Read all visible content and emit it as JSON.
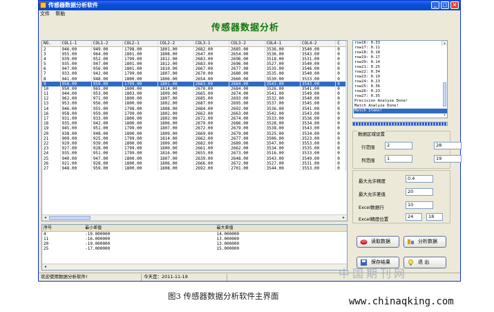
{
  "window": {
    "title": "传感器数据分析软件",
    "menu": [
      "文件",
      "帮助"
    ],
    "app_title": "传感器数据分析"
  },
  "grid": {
    "headers": [
      "NO.",
      "COL1-1",
      "COL1-2",
      "COL2-1",
      "COL2-2",
      "COL3-1",
      "COL3-2",
      "COL4-1",
      "COL4-2",
      "C"
    ],
    "rows": [
      [
        "2",
        "946.00",
        "949.00",
        "1798.00",
        "1801.00",
        "2682.00",
        "2685.00",
        "3536.00",
        "3540.00",
        "0"
      ],
      [
        "3",
        "955.00",
        "964.00",
        "1801.00",
        "1808.00",
        "2647.00",
        "2654.00",
        "3536.00",
        "3543.00",
        "0"
      ],
      [
        "4",
        "939.00",
        "952.00",
        "1799.00",
        "1812.00",
        "2683.00",
        "2696.00",
        "3518.00",
        "3531.00",
        "0"
      ],
      [
        "5",
        "935.00",
        "947.00",
        "1801.00",
        "1812.00",
        "2683.00",
        "2696.00",
        "3527.00",
        "3540.00",
        "0"
      ],
      [
        "6",
        "947.00",
        "956.00",
        "1801.00",
        "1810.00",
        "2667.00",
        "2677.00",
        "3535.00",
        "3546.00",
        "0"
      ],
      [
        "7",
        "933.00",
        "942.00",
        "1799.00",
        "1807.00",
        "2670.00",
        "2680.00",
        "3535.00",
        "3540.00",
        "0"
      ],
      [
        "8",
        "941.00",
        "948.00",
        "1800.00",
        "1806.00",
        "2654.00",
        "2660.00",
        "3530.00",
        "3533.00",
        "0"
      ],
      [
        "9",
        "958.00",
        "959.00",
        "1799.00",
        "1801.00",
        "2683.00",
        "2684.00",
        "3543.00",
        "3543.00",
        "0"
      ],
      [
        "10",
        "950.00",
        "965.00",
        "1800.00",
        "1814.00",
        "2670.00",
        "2684.00",
        "3526.00",
        "3541.00",
        "0"
      ],
      [
        "11",
        "944.00",
        "953.00",
        "1803.00",
        "1809.00",
        "2665.00",
        "2674.00",
        "3541.00",
        "3549.00",
        "0"
      ],
      [
        "12",
        "962.00",
        "971.00",
        "1800.00",
        "1807.00",
        "2685.00",
        "2693.00",
        "3532.00",
        "3540.00",
        "0"
      ],
      [
        "13",
        "953.00",
        "956.00",
        "1800.00",
        "1802.00",
        "2687.00",
        "2695.00",
        "3537.00",
        "3545.00",
        "0"
      ],
      [
        "14",
        "946.00",
        "955.00",
        "1798.00",
        "1808.00",
        "2684.00",
        "2692.00",
        "3536.00",
        "3541.00",
        "0"
      ],
      [
        "16",
        "958.00",
        "959.00",
        "1799.00",
        "1802.00",
        "2662.00",
        "2663.00",
        "3542.00",
        "3543.00",
        "0"
      ],
      [
        "17",
        "931.00",
        "933.00",
        "1800.00",
        "1802.00",
        "2672.00",
        "2674.00",
        "3533.00",
        "3536.00",
        "0"
      ],
      [
        "18",
        "935.00",
        "942.00",
        "1800.00",
        "1806.00",
        "2679.00",
        "2686.00",
        "3528.00",
        "3534.00",
        "0"
      ],
      [
        "19",
        "945.00",
        "951.00",
        "1799.00",
        "1807.00",
        "2672.00",
        "2679.00",
        "3538.00",
        "3543.00",
        "0"
      ],
      [
        "20",
        "938.00",
        "948.00",
        "1800.00",
        "1809.00",
        "2669.00",
        "2679.00",
        "3525.00",
        "3534.00",
        "0"
      ],
      [
        "21",
        "909.00",
        "925.00",
        "1799.00",
        "1814.00",
        "2662.00",
        "2677.00",
        "3506.00",
        "3523.00",
        "0"
      ],
      [
        "22",
        "929.00",
        "939.00",
        "1800.00",
        "1809.00",
        "2682.00",
        "2689.00",
        "3547.00",
        "3553.00",
        "0"
      ],
      [
        "23",
        "927.00",
        "928.00",
        "1799.00",
        "1800.00",
        "2661.00",
        "2662.00",
        "3534.00",
        "3535.00",
        "0"
      ],
      [
        "24",
        "935.00",
        "951.00",
        "1799.00",
        "1816.00",
        "2655.00",
        "2673.00",
        "3516.00",
        "3533.00",
        "0"
      ],
      [
        "25",
        "940.00",
        "947.00",
        "1800.00",
        "1807.00",
        "2639.00",
        "2648.00",
        "3543.00",
        "3549.00",
        "0"
      ],
      [
        "26",
        "921.00",
        "928.00",
        "1800.00",
        "1806.00",
        "2666.00",
        "2672.00",
        "3527.00",
        "3531.00",
        "0"
      ],
      [
        "27",
        "948.00",
        "959.00",
        "1800.00",
        "1808.00",
        "2692.00",
        "2701.00",
        "3544.00",
        "3553.00",
        "0"
      ]
    ]
  },
  "bottom_table": {
    "headers": [
      "序号",
      "最小差值",
      "最大差值"
    ],
    "rows": [
      [
        "4",
        "-19.000000",
        "14.000000"
      ],
      [
        "11",
        "-16.000000",
        "13.000000"
      ],
      [
        "20",
        "-19.000000",
        "13.000000"
      ],
      [
        "25",
        "-17.000000",
        "15.000000"
      ]
    ]
  },
  "log": [
    "row16:  0.33",
    "row17:  0.11",
    "row18:  0.18",
    "row19:  0.17",
    "row20:  0.14",
    "row21:  0.25",
    "row22:  0.34",
    "row23:  0.19",
    "row24:  0.23",
    "row25:  0.36",
    "row26:  0.23",
    "row27:  0.35",
    "Precision Analyze Done!",
    "Match Analyze Done!",
    "Match Items!"
  ],
  "range": {
    "title": "数据区域设置",
    "row_label": "行范围",
    "row_from": "2",
    "row_to": "28",
    "col_label": "列范围",
    "col_from": "1",
    "col_to": "19"
  },
  "params": {
    "precision_label": "最大允许精度",
    "precision": "0.4",
    "diff_label": "最大允许差值",
    "diff": "20",
    "excel_row_label": "Excel数据行",
    "excel_row": "10",
    "excel_pos_label": "Excel精度位置",
    "excel_pos_a": "24",
    "excel_pos_b": "18"
  },
  "buttons": {
    "read": "读取数据",
    "analyze": "分析数据",
    "save": "保存结果",
    "exit": "退   出"
  },
  "status": {
    "message": "欢迎使用数据分析软件!",
    "date": "今天是：2011-11-19"
  },
  "progress": {
    "percent": 100
  },
  "caption": "图3 传感器数据分析软件主界面",
  "watermark": "中国期刊网",
  "url": "www.chinaqking.com",
  "colors": {
    "title_green": "#0f7a0f",
    "selection": "#316ac5",
    "titlebar": "#0a4fd8"
  }
}
